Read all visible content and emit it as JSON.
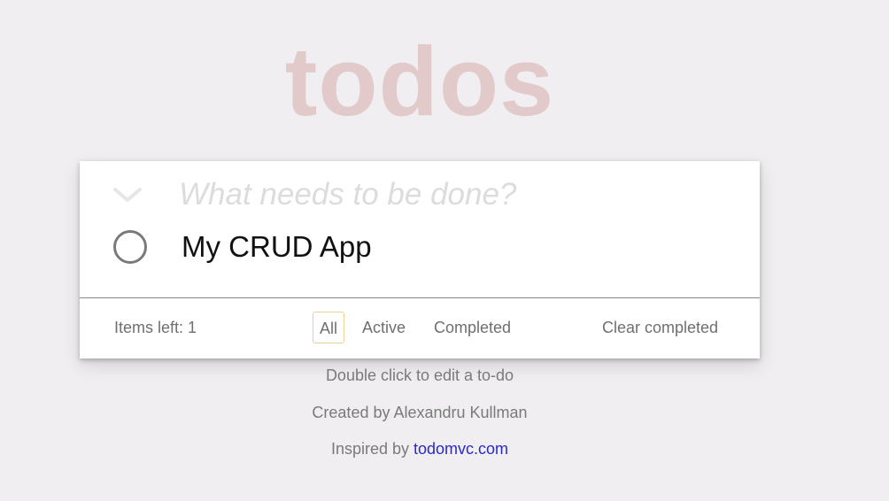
{
  "header": {
    "title": "todos"
  },
  "new_todo": {
    "placeholder": "What needs to be done?",
    "value": ""
  },
  "toggle_all": {
    "icon": "chevron-down-icon"
  },
  "todos": [
    {
      "label": "My CRUD App",
      "completed": false
    }
  ],
  "footer": {
    "count_text": "Items left: 1",
    "filters": [
      {
        "label": "All",
        "selected": true
      },
      {
        "label": "Active",
        "selected": false
      },
      {
        "label": "Completed",
        "selected": false
      }
    ],
    "clear_label": "Clear completed"
  },
  "info": {
    "edit_hint": "Double click to edit a to-do",
    "credit": "Created by Alexandru Kullman",
    "inspired_prefix": "Inspired by ",
    "inspired_link": "todomvc.com"
  },
  "colors": {
    "title": "#e2c9ca",
    "background": "#f0eef0",
    "selected_filter_border": "#e9d29a",
    "link": "#2a2ac8"
  }
}
